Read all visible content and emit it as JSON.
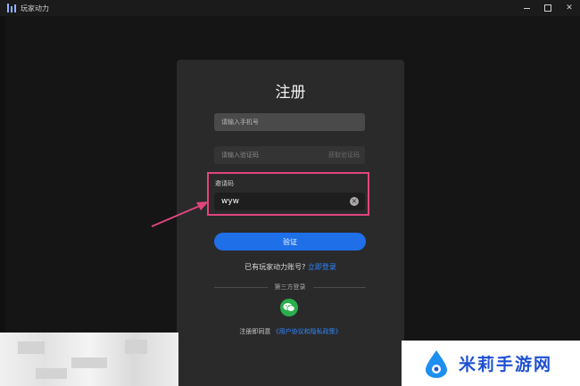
{
  "window": {
    "title": "玩家动力",
    "min_icon": "minimize-icon",
    "max_icon": "maximize-icon",
    "close_label": "✕"
  },
  "register": {
    "title": "注册",
    "phone_placeholder": "请输入手机号",
    "code_placeholder": "请输入验证码",
    "code_link": "获取验证码",
    "invite_label": "邀请码",
    "invite_value": "wyw",
    "clear_label": "×",
    "verify_button": "验证",
    "has_account": "已有玩家动力账号?",
    "login_link": "立即登录",
    "third_party": "第三方登录",
    "agreement_prefix": "注册即同意",
    "agreement_link": "《用户协议和隐私政策》"
  },
  "watermark": {
    "text": "米莉手游网"
  },
  "colors": {
    "accent": "#1f6fe8",
    "highlight": "#e0457e",
    "wechat": "#2aae4d",
    "watermark": "#1d4fd1"
  }
}
